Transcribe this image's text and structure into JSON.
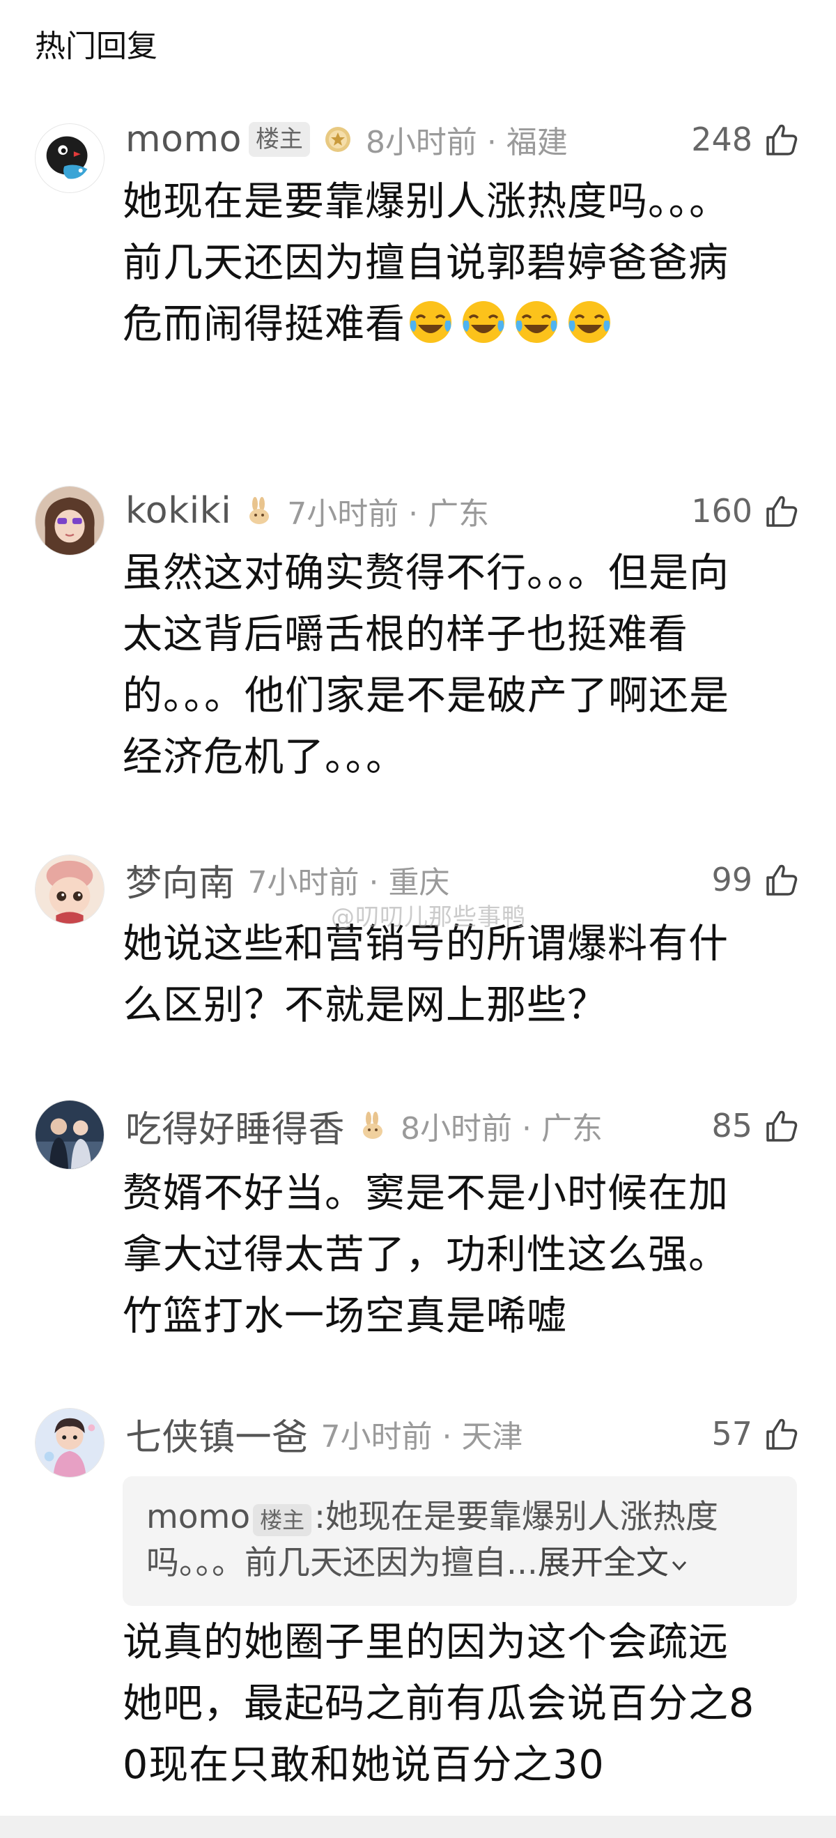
{
  "section_title": "热门回复",
  "watermark": "@叨叨儿那些事鸭",
  "comments": [
    {
      "username": "momo",
      "op_badge": "楼主",
      "medal_icon": "gold-medal-icon",
      "time_location": "8小时前 · 福建",
      "likes": "248",
      "text": "她现在是要靠爆别人涨热度吗。。。前几天还因为擅自说郭碧婷爸爸病危而闹得挺难看",
      "emojis": [
        "laugh-cry-emoji",
        "laugh-cry-emoji",
        "laugh-cry-emoji",
        "laugh-cry-emoji"
      ]
    },
    {
      "username": "kokiki",
      "medal_icon": "rabbit-icon",
      "time_location": "7小时前 · 广东",
      "likes": "160",
      "text": "虽然这对确实赘得不行。。。但是向太这背后嚼舌根的样子也挺难看的。。。他们家是不是破产了啊还是经济危机了。。。"
    },
    {
      "username": "梦向南",
      "time_location": "7小时前 · 重庆",
      "likes": "99",
      "text": "她说这些和营销号的所谓爆料有什么区别？不就是网上那些？"
    },
    {
      "username": "吃得好睡得香",
      "medal_icon": "rabbit-icon",
      "time_location": "8小时前 · 广东",
      "likes": "85",
      "text": "赘婿不好当。窦是不是小时候在加拿大过得太苦了，功利性这么强。竹篮打水一场空真是唏嘘"
    },
    {
      "username": "七侠镇一爸",
      "time_location": "7小时前 · 天津",
      "likes": "57",
      "quote": {
        "username": "momo",
        "op_badge": "楼主",
        "separator": ":",
        "text_line1": "她现在是要靠爆别人涨热度",
        "text_line2": "吗。。。前几天还因为擅自...",
        "expand_label": "展开全文"
      },
      "text": "说真的她圈子里的因为这个会疏远她吧，最起码之前有瓜会说百分之80现在只敢和她说百分之30"
    }
  ],
  "colors": {
    "text_primary": "#111111",
    "text_secondary": "#9a9a9a",
    "quote_bg": "#f4f4f4"
  }
}
